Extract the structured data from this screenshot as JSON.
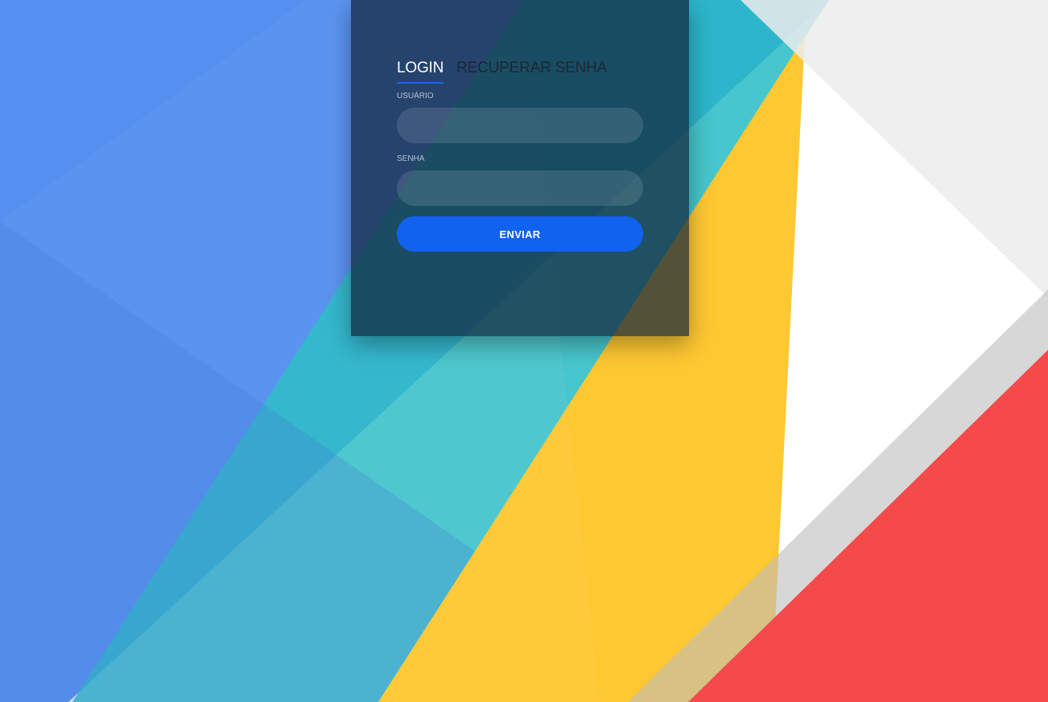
{
  "tabs": {
    "login_label": "LOGIN",
    "recover_label": "RECUPERAR SENHA"
  },
  "form": {
    "username_label": "USUÁRIO",
    "username_value": "",
    "password_label": "SENHA",
    "password_value": "",
    "submit_label": "ENVIAR"
  },
  "colors": {
    "blue": "#5590f0",
    "teal": "#27bcc4",
    "yellow": "#fec832",
    "red": "#f44a4a",
    "gray": "#ececec",
    "accent": "#1162ee"
  }
}
